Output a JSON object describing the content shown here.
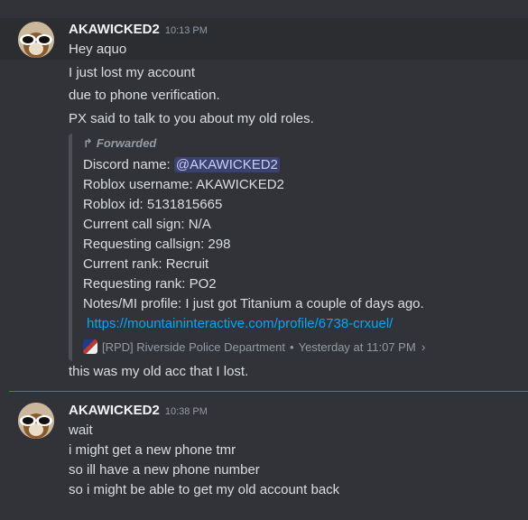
{
  "messages": [
    {
      "username": "AKAWICKED2",
      "timestamp": "10:13 PM",
      "lines": [
        "Hey aquo",
        "I just lost my account",
        "due to phone verification.",
        "PX said to talk to you about my old roles."
      ],
      "forwarded": {
        "header": "Forwarded",
        "discord_name_label": "Discord name: ",
        "mention": "@AKAWICKED2",
        "lines": [
          "Roblox username: AKAWICKED2",
          "Roblox id: 5131815665",
          "Current call sign: N/A",
          "Requesting callsign: 298",
          "Current rank: Recruit",
          "Requesting rank: PO2",
          "Notes/MI profile: I just got Titanium a couple of days ago."
        ],
        "link": "https://mountaininteractive.com/profile/6738-crxuel/",
        "source_server": "[RPD] Riverside Police Department",
        "source_time": "Yesterday at 11:07 PM"
      },
      "after_line": "this was my old acc that I lost."
    },
    {
      "username": "AKAWICKED2",
      "timestamp": "10:38 PM",
      "lines": [
        "wait",
        "i might get a new phone tmr",
        "so ill have a new phone number",
        "so i might be able to get my old account back"
      ]
    }
  ],
  "icons": {
    "forward": "forward-arrow-icon",
    "chevron": "chevron-right-icon"
  },
  "colors": {
    "mention_bg": "#3c4270",
    "link": "#00a8fc",
    "new_divider": "#d83c3e"
  }
}
